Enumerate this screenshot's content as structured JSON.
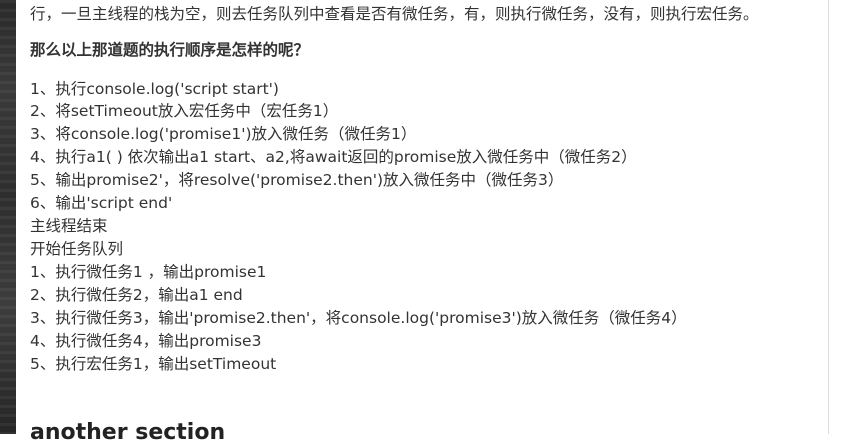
{
  "article": {
    "intro_line": "行，一旦主线程的栈为空，则去任务队列中查看是否有微任务，有，则执行微任务，没有，则执行宏任务。",
    "question_heading": "那么以上那道题的执行顺序是怎样的呢？",
    "steps": [
      "  1、执行console.log('script start')",
      "2、将setTimeout放入宏任务中（宏任务1）",
      "3、将console.log('promise1')放入微任务（微任务1）",
      "4、执行a1( ) 依次输出a1 start、a2,将await返回的promise放入微任务中（微任务2）",
      "5、输出promise2'，将resolve('promise2.then')放入微任务中（微任务3）",
      "6、输出'script end'",
      "主线程结束",
      "开始任务队列",
      "1、执行微任务1 ，输出promise1",
      "2、执行微任务2，输出a1 end",
      "3、执行微任务3，输出'promise2.then'，将console.log('promise3')放入微任务（微任务4）",
      "4、执行微任务4，输出promise3",
      "5、执行宏任务1，输出setTimeout"
    ],
    "next_section_title": "another section"
  }
}
